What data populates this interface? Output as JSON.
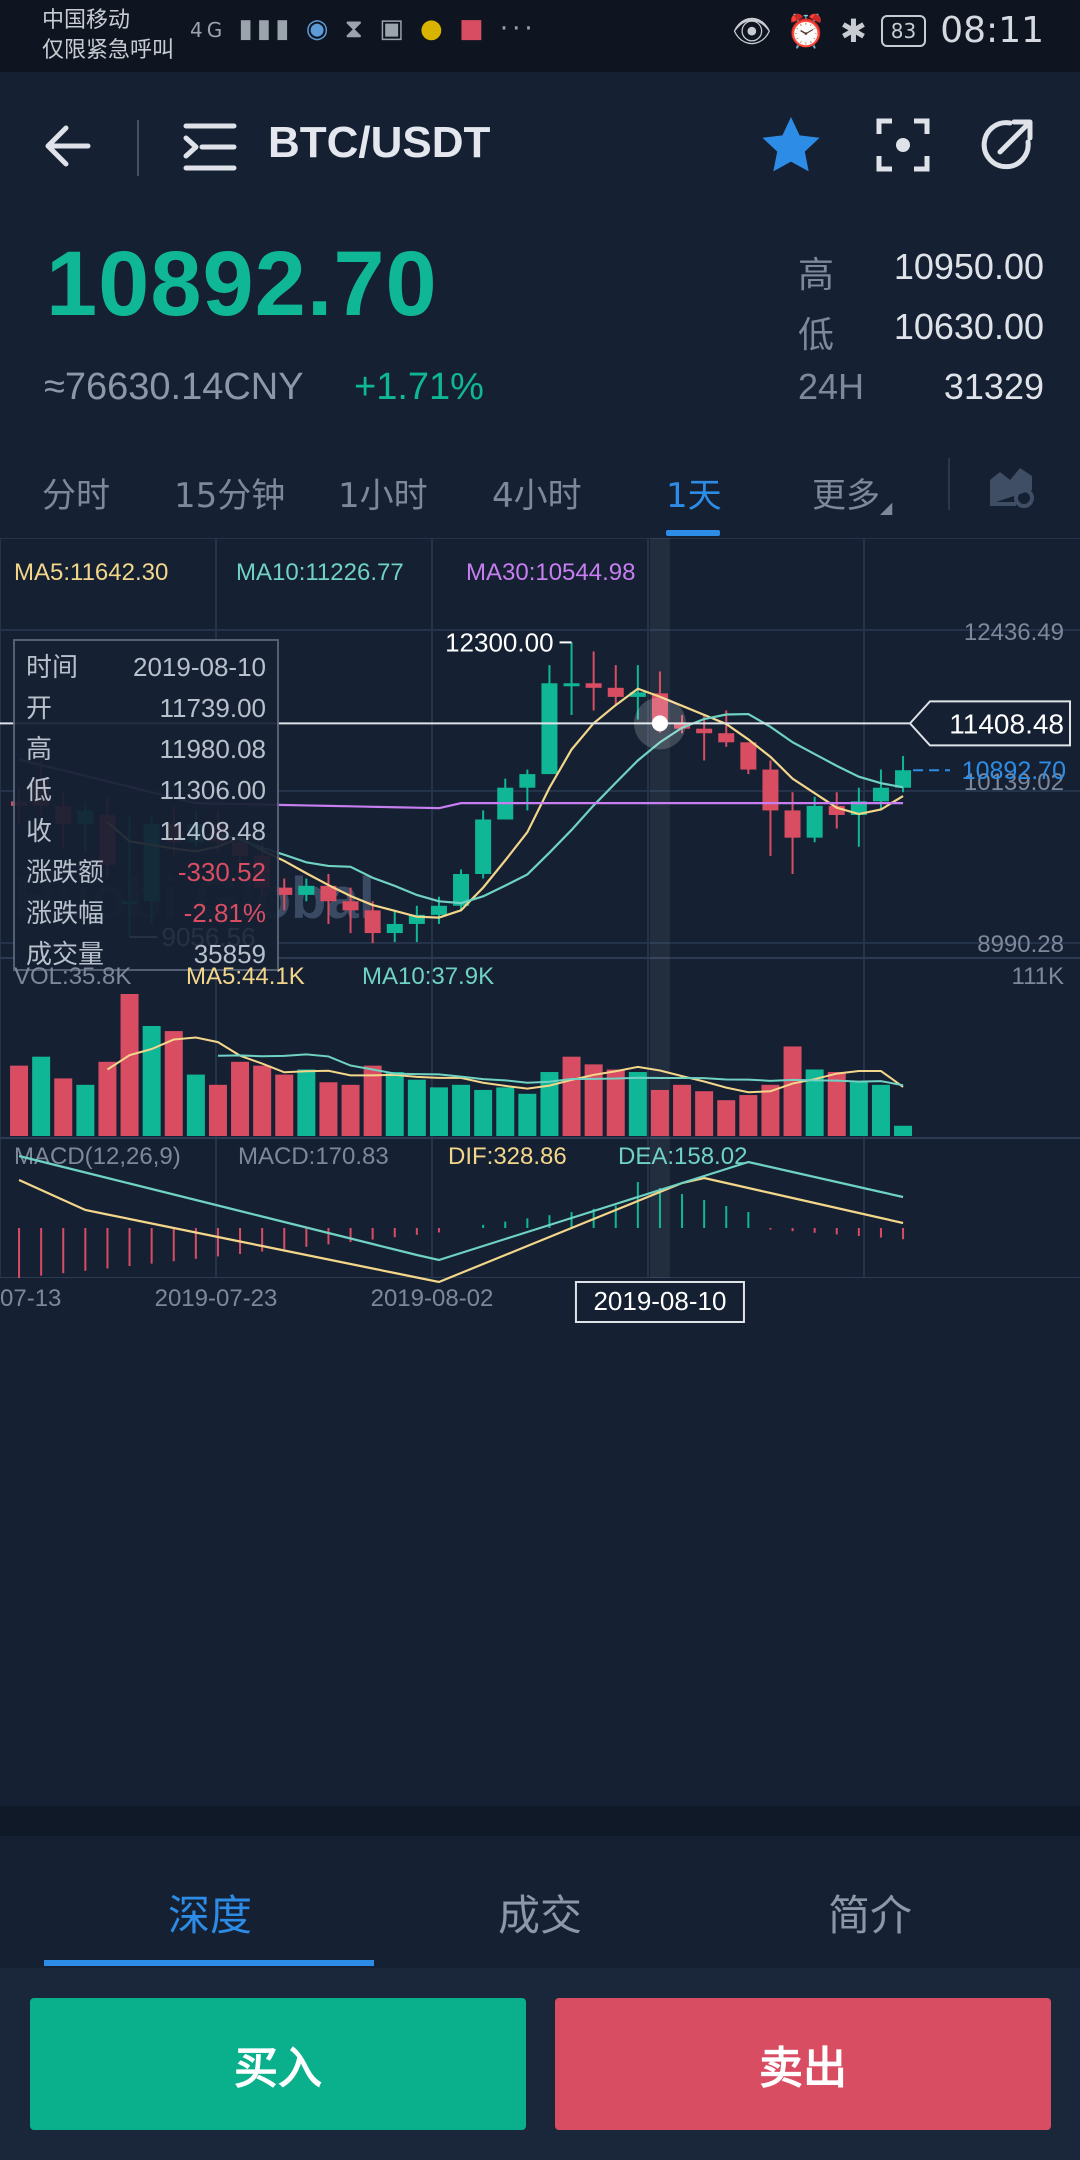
{
  "status_bar": {
    "carrier_line1": "中国移动",
    "carrier_line2": "仅限紧急呼叫",
    "network": "4G",
    "battery": "83",
    "time": "08:11"
  },
  "header": {
    "pair": "BTC/USDT",
    "icons": [
      "back-arrow-icon",
      "menu-icon",
      "star-icon",
      "scan-icon",
      "share-icon"
    ]
  },
  "ticker": {
    "price": "10892.70",
    "cny": "≈76630.14CNY",
    "change": "+1.71%",
    "high_label": "高",
    "high": "10950.00",
    "low_label": "低",
    "low": "10630.00",
    "vol_label": "24H",
    "vol": "31329"
  },
  "periods": {
    "items": [
      "分时",
      "15分钟",
      "1小时",
      "4小时",
      "1天",
      "更多"
    ],
    "active": "1天"
  },
  "colors": {
    "up": "#10b796",
    "down": "#d94d63",
    "ma5": "#f3d68a",
    "ma10": "#6fd2c2",
    "ma30": "#c77ef0",
    "accent": "#2d8ce6"
  },
  "indicators": {
    "ma5": "MA5:11642.30",
    "ma10": "MA10:11226.77",
    "ma30": "MA30:10544.98",
    "vol": "VOL:35.8K",
    "vol_ma5": "MA5:44.1K",
    "vol_ma10": "MA10:37.9K",
    "vol_max": "111K",
    "macd_title": "MACD(12,26,9)",
    "macd": "MACD:170.83",
    "dif": "DIF:328.86",
    "dea": "DEA:158.02"
  },
  "crosshair": {
    "date": "2019-08-10",
    "price_tag": "11408.48",
    "last_price_tag": "10892.70",
    "rows": [
      {
        "k": "时间",
        "v": "2019-08-10"
      },
      {
        "k": "开",
        "v": "11739.00"
      },
      {
        "k": "高",
        "v": "11980.08"
      },
      {
        "k": "低",
        "v": "11306.00"
      },
      {
        "k": "收",
        "v": "11408.48"
      },
      {
        "k": "涨跌额",
        "v": "-330.52"
      },
      {
        "k": "涨跌幅",
        "v": "-2.81%"
      },
      {
        "k": "成交量",
        "v": "35859"
      }
    ]
  },
  "chart_data": {
    "type": "candlestick",
    "y_axis_labels": [
      "12436.49",
      "10139.02",
      "8990.28"
    ],
    "annotations": {
      "max": "12300.00",
      "min": "9056.56"
    },
    "x_labels": [
      "07-13",
      "2019-07-23",
      "2019-08-02",
      "2019-08-10"
    ],
    "ylim": [
      8990.28,
      12436.49
    ],
    "candles": [
      [
        10550,
        10700,
        10300,
        10500
      ],
      [
        10800,
        11000,
        10400,
        10500
      ],
      [
        10500,
        10650,
        10050,
        10300
      ],
      [
        10300,
        10550,
        10000,
        10450
      ],
      [
        10400,
        10600,
        9700,
        9850
      ],
      [
        9450,
        10380,
        9056.56,
        9450
      ],
      [
        9450,
        10400,
        9200,
        10300
      ],
      [
        10300,
        10500,
        9950,
        10100
      ],
      [
        10100,
        10450,
        10050,
        10300
      ],
      [
        10300,
        10450,
        9990,
        10100
      ],
      [
        10100,
        10200,
        9850,
        9950
      ],
      [
        9950,
        10100,
        9500,
        9600
      ],
      [
        9600,
        9700,
        9350,
        9520
      ],
      [
        9520,
        9700,
        9450,
        9620
      ],
      [
        9620,
        9750,
        9200,
        9450
      ],
      [
        9450,
        9600,
        9100,
        9350
      ],
      [
        9350,
        9450,
        8990,
        9100
      ],
      [
        9100,
        9350,
        9000,
        9200
      ],
      [
        9200,
        9400,
        9000,
        9300
      ],
      [
        9300,
        9500,
        9200,
        9400
      ],
      [
        9400,
        9800,
        9350,
        9750
      ],
      [
        9750,
        10450,
        9700,
        10350
      ],
      [
        10350,
        10800,
        10350,
        10700
      ],
      [
        10700,
        10900,
        10450,
        10850
      ],
      [
        10850,
        12050,
        10850,
        11850
      ],
      [
        11850,
        12300,
        11500,
        11850
      ],
      [
        11850,
        12200,
        11550,
        11800
      ],
      [
        11800,
        12050,
        11600,
        11700
      ],
      [
        11700,
        12050,
        11450,
        11750
      ],
      [
        11739,
        11980.08,
        11306,
        11408.48
      ],
      [
        11408,
        11500,
        11300,
        11350
      ],
      [
        11350,
        11500,
        11000,
        11300
      ],
      [
        11300,
        11550,
        11150,
        11200
      ],
      [
        11200,
        11200,
        10850,
        10900
      ],
      [
        10900,
        11000,
        9950,
        10450
      ],
      [
        10450,
        10650,
        9750,
        10150
      ],
      [
        10150,
        10600,
        10100,
        10500
      ],
      [
        10500,
        10650,
        10250,
        10400
      ],
      [
        10400,
        10700,
        10050,
        10550
      ],
      [
        10550,
        10900,
        10450,
        10700
      ],
      [
        10700,
        11050,
        10650,
        10892.7
      ]
    ],
    "volumes": [
      55,
      62,
      45,
      40,
      58,
      111,
      86,
      82,
      48,
      40,
      58,
      55,
      48,
      52,
      42,
      40,
      55,
      50,
      44,
      38,
      40,
      36,
      38,
      33,
      50,
      62,
      56,
      52,
      50,
      36,
      40,
      35,
      28,
      32,
      40,
      70,
      52,
      50,
      42,
      40,
      8
    ],
    "vol_up": [
      0,
      1,
      0,
      1,
      0,
      0,
      1,
      0,
      1,
      0,
      0,
      0,
      0,
      1,
      0,
      0,
      0,
      1,
      1,
      1,
      1,
      1,
      1,
      1,
      1,
      0,
      0,
      0,
      1,
      0,
      0,
      0,
      0,
      0,
      0,
      0,
      1,
      0,
      1,
      1,
      1
    ]
  },
  "bottom_tabs": {
    "items": [
      "深度",
      "成交",
      "简介"
    ],
    "active": "深度"
  },
  "actions": {
    "buy": "买入",
    "sell": "卖出"
  },
  "watermark": "Huobi Global"
}
